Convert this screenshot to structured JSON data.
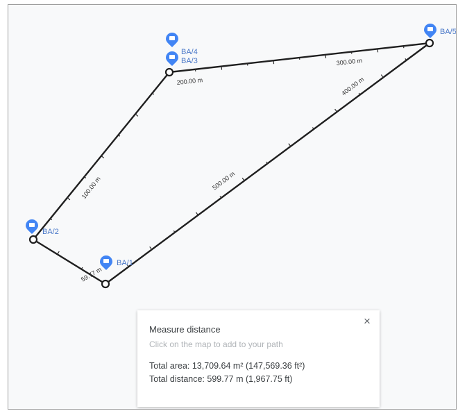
{
  "map": {
    "pins": [
      {
        "id": "BA/1",
        "label": "BA/1"
      },
      {
        "id": "BA/2",
        "label": "BA/2"
      },
      {
        "id": "BA/3",
        "label": "BA/3"
      },
      {
        "id": "BA/4",
        "label": "BA/4"
      },
      {
        "id": "BA/5",
        "label": "BA/5"
      }
    ],
    "distance_labels": [
      "59.77 m",
      "100.00 m",
      "200.00 m",
      "300.00 m",
      "400.00 m",
      "500.00 m"
    ],
    "colors": {
      "pin": "#4285f4",
      "pin_label": "#4a78c8",
      "path": "#1f1f1f",
      "vertex_fill": "#ffffff"
    },
    "icons": {
      "pin": "map-pin-icon",
      "vertex": "path-vertex-icon"
    }
  },
  "panel": {
    "title": "Measure distance",
    "hint": "Click on the map to add to your path",
    "total_area": "Total area: 13,709.64 m² (147,569.36 ft²)",
    "total_distance": "Total distance: 599.77 m (1,967.75 ft)",
    "close_icon": "close-icon",
    "close_glyph": "×"
  }
}
